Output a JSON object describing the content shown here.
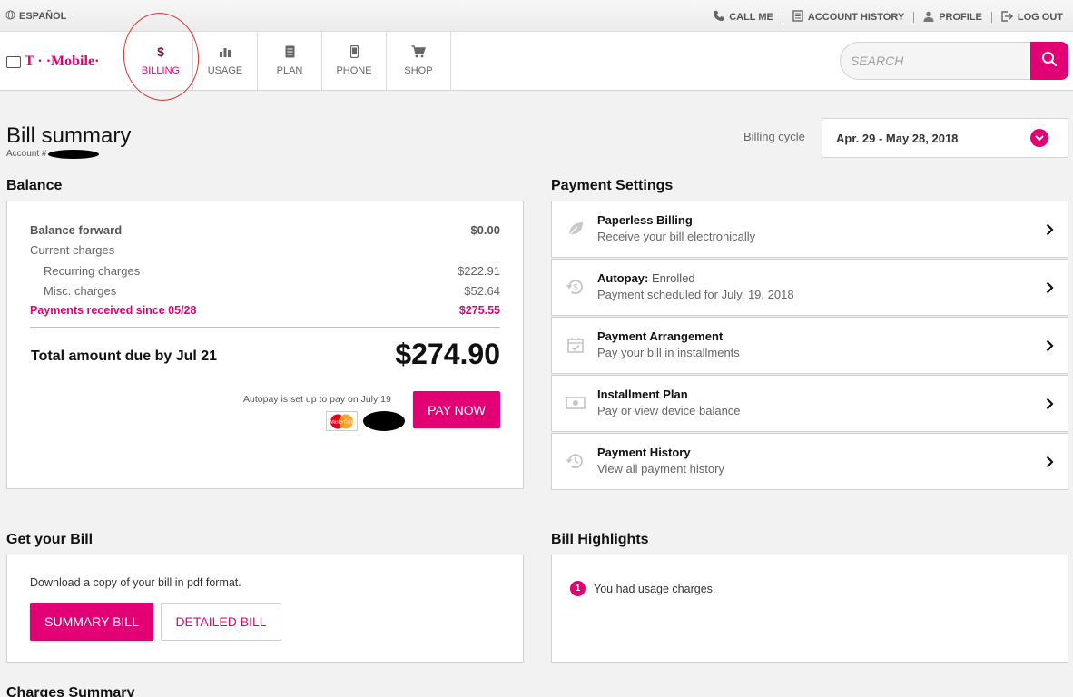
{
  "utility_bar": {
    "language": "ESPAÑOL",
    "links": [
      {
        "label": "CALL ME",
        "icon": "phone-icon"
      },
      {
        "label": "ACCOUNT HISTORY",
        "icon": "document-icon"
      },
      {
        "label": "PROFILE",
        "icon": "person-icon"
      },
      {
        "label": "LOG OUT",
        "icon": "logout-icon"
      }
    ]
  },
  "header": {
    "brand": "T · ·Mobile·",
    "tabs": [
      {
        "label": "BILLING",
        "icon": "dollar-icon",
        "active": true
      },
      {
        "label": "USAGE",
        "icon": "bar-chart-icon",
        "active": false
      },
      {
        "label": "PLAN",
        "icon": "plan-icon",
        "active": false
      },
      {
        "label": "PHONE",
        "icon": "phone-device-icon",
        "active": false
      },
      {
        "label": "SHOP",
        "icon": "cart-icon",
        "active": false
      }
    ],
    "search_placeholder": "SEARCH"
  },
  "page": {
    "title": "Bill summary",
    "account_label": "Account #",
    "billing_cycle_label": "Billing cycle",
    "billing_cycle_value": "Apr. 29 - May 28, 2018"
  },
  "balance": {
    "heading": "Balance",
    "balance_forward_label": "Balance forward",
    "balance_forward_value": "$0.00",
    "current_charges_label": "Current charges",
    "recurring_label": "Recurring charges",
    "recurring_value": "$222.91",
    "misc_label": "Misc. charges",
    "misc_value": "$52.64",
    "payments_label": "Payments received since 05/28",
    "payments_value": "$275.55",
    "total_label": "Total amount due by Jul 21",
    "total_value": "$274.90",
    "autopay_note": "Autopay is set up to pay on July 19",
    "card_brand": "MasterCard",
    "pay_now_label": "PAY NOW"
  },
  "payment_settings": {
    "heading": "Payment Settings",
    "items": [
      {
        "title": "Paperless Billing",
        "title_suffix": "",
        "subtitle": "Receive your bill electronically",
        "icon": "leaf-icon"
      },
      {
        "title": "Autopay:",
        "title_suffix": " Enrolled",
        "subtitle": "Payment scheduled for July. 19, 2018",
        "icon": "autopay-dollar-icon"
      },
      {
        "title": "Payment Arrangement",
        "title_suffix": "",
        "subtitle": "Pay your bill in installments",
        "icon": "calendar-check-icon"
      },
      {
        "title": "Installment Plan",
        "title_suffix": "",
        "subtitle": "Pay or view device balance",
        "icon": "cash-icon"
      },
      {
        "title": "Payment History",
        "title_suffix": "",
        "subtitle": "View all payment history",
        "icon": "history-icon"
      }
    ]
  },
  "get_bill": {
    "heading": "Get your Bill",
    "description": "Download a copy of your bill in pdf format.",
    "summary_label": "SUMMARY BILL",
    "detailed_label": "DETAILED BILL"
  },
  "highlights": {
    "heading": "Bill Highlights",
    "items": [
      {
        "number": "1",
        "text": "You had usage charges."
      }
    ]
  },
  "charges_summary": {
    "heading": "Charges Summary"
  },
  "colors": {
    "brand": "#e20074",
    "annotation": "#d9332c"
  }
}
